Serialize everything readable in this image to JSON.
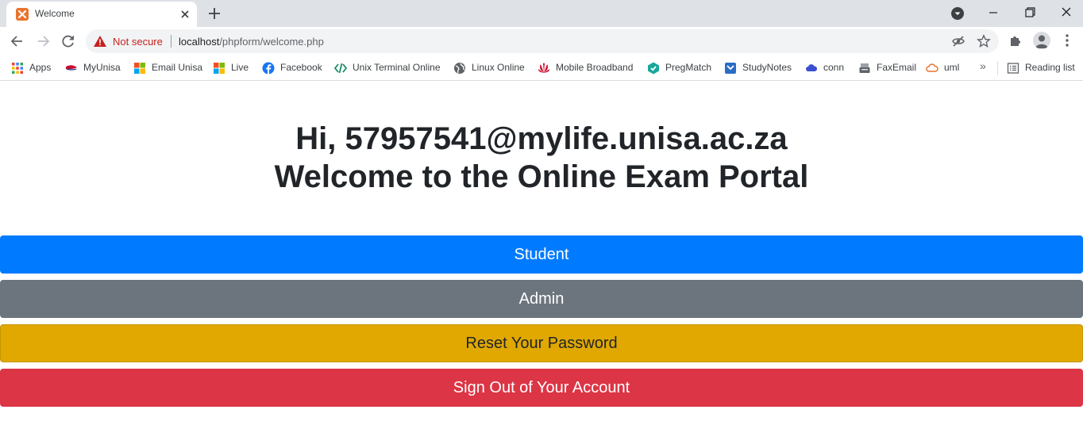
{
  "tab": {
    "title": "Welcome"
  },
  "address_bar": {
    "security_label": "Not secure",
    "url_host": "localhost",
    "url_path": "/phpform/welcome.php"
  },
  "bookmarks": [
    {
      "label": "Apps",
      "icon": "apps-grid-icon"
    },
    {
      "label": "MyUnisa",
      "icon": "myunisa-icon"
    },
    {
      "label": "Email Unisa",
      "icon": "microsoft-icon"
    },
    {
      "label": "Live",
      "icon": "microsoft-icon"
    },
    {
      "label": "Facebook",
      "icon": "facebook-icon"
    },
    {
      "label": "Unix Terminal Online",
      "icon": "code-icon"
    },
    {
      "label": "Linux Online",
      "icon": "globe-icon"
    },
    {
      "label": "Mobile Broadband",
      "icon": "huawei-icon"
    },
    {
      "label": "PregMatch",
      "icon": "pregmatch-icon"
    },
    {
      "label": "StudyNotes",
      "icon": "studynotes-icon"
    },
    {
      "label": "conn",
      "icon": "cloud-icon"
    },
    {
      "label": "FaxEmail",
      "icon": "faxemail-icon"
    },
    {
      "label": "uml",
      "icon": "cloud-outline-icon"
    }
  ],
  "bookmarks_overflow": "»",
  "reading_list": "Reading list",
  "page": {
    "greeting_prefix": "Hi,",
    "username": "57957541@mylife.unisa.ac.za",
    "title": "Welcome to the Online Exam Portal",
    "buttons": {
      "student": "Student",
      "admin": "Admin",
      "reset": "Reset Your Password",
      "signout": "Sign Out of Your Account"
    }
  },
  "colors": {
    "primary": "#007bff",
    "secondary": "#6c757d",
    "warning": "#e0a800",
    "danger": "#dc3545"
  }
}
